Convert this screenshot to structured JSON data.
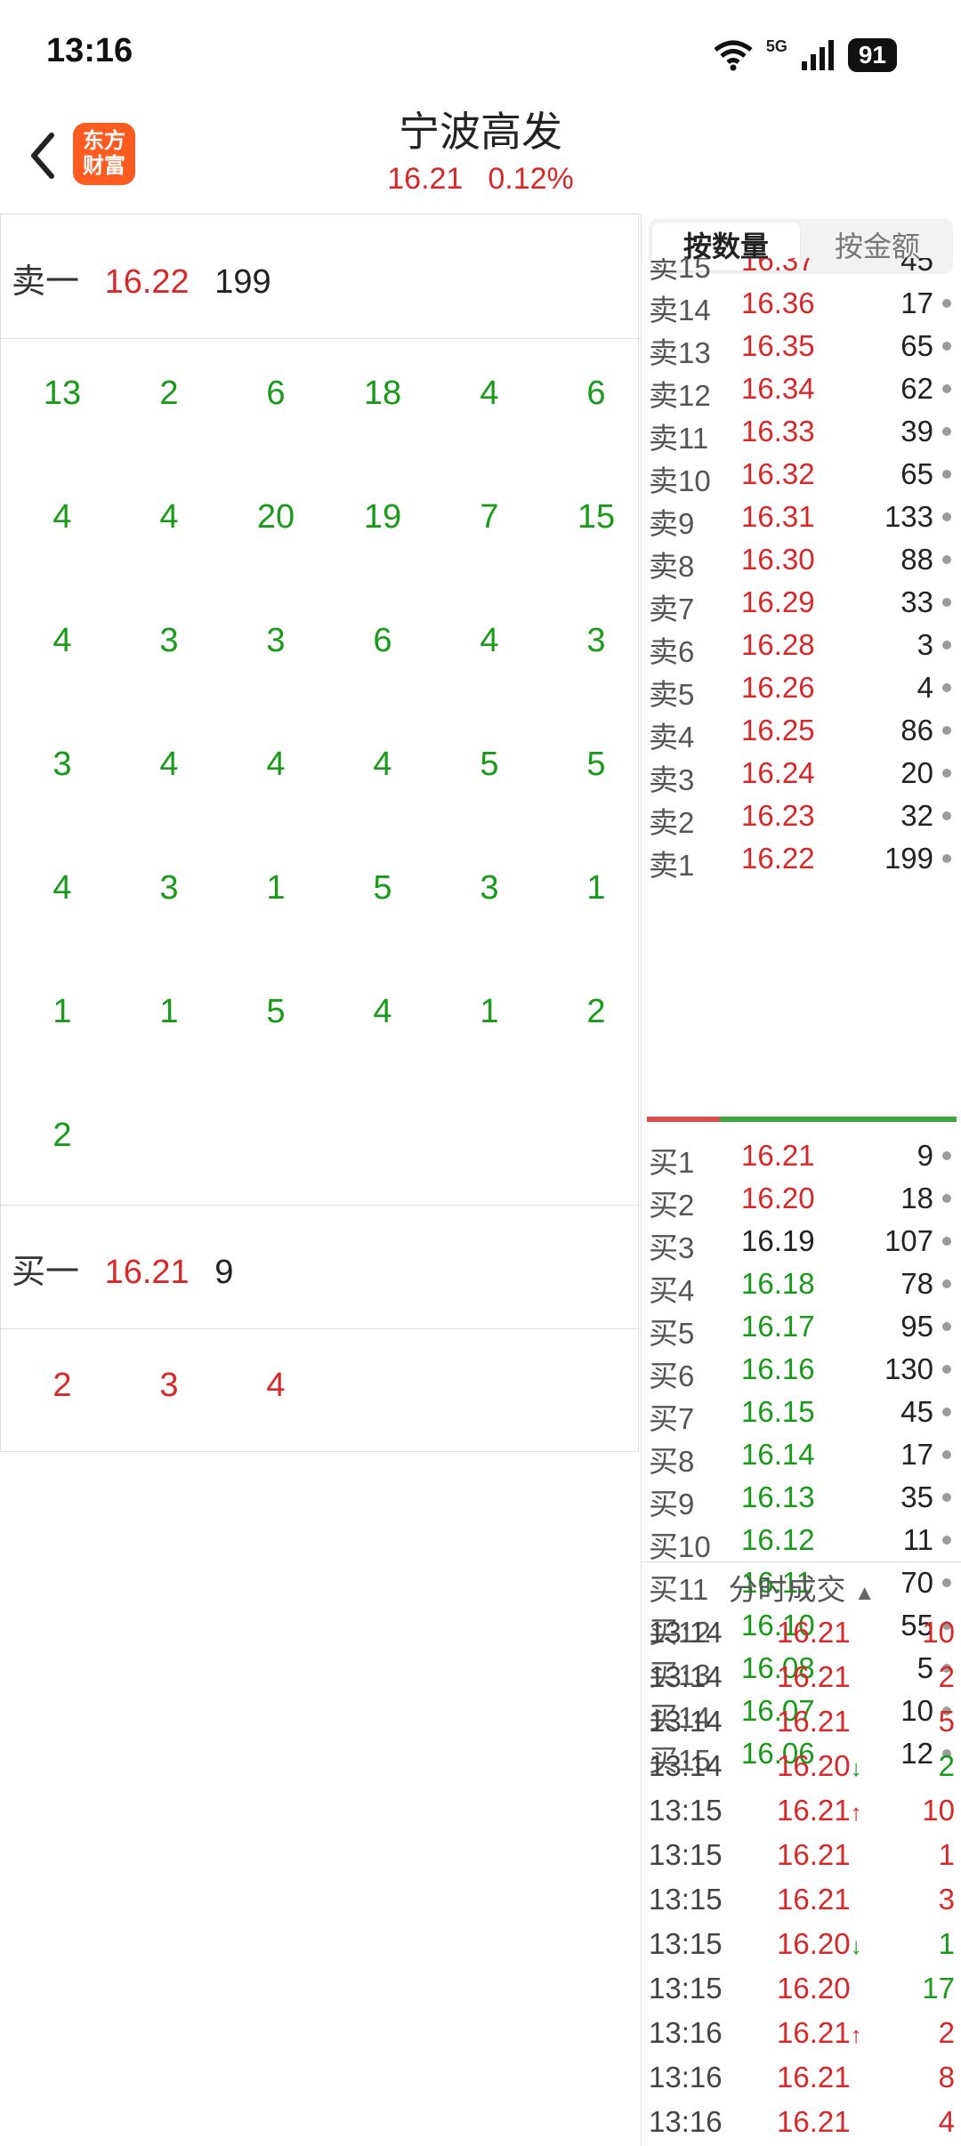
{
  "status_bar": {
    "time": "13:16",
    "network": "5G",
    "battery": "91"
  },
  "header": {
    "title": "宁波高发",
    "price": "16.21",
    "change_pct": "0.12%",
    "logo_text_line1": "东方",
    "logo_text_line2": "财富"
  },
  "left_panel": {
    "sell1": {
      "label": "卖一",
      "price": "16.22",
      "volume": "199"
    },
    "sell1_queue": [
      [
        "13",
        "2",
        "6",
        "18",
        "4",
        "6"
      ],
      [
        "4",
        "4",
        "20",
        "19",
        "7",
        "15"
      ],
      [
        "4",
        "3",
        "3",
        "6",
        "4",
        "3"
      ],
      [
        "3",
        "4",
        "4",
        "4",
        "5",
        "5"
      ],
      [
        "4",
        "3",
        "1",
        "5",
        "3",
        "1"
      ],
      [
        "1",
        "1",
        "5",
        "4",
        "1",
        "2"
      ],
      [
        "2"
      ]
    ],
    "buy1": {
      "label": "买一",
      "price": "16.21",
      "volume": "9"
    },
    "buy1_queue": [
      "2",
      "3",
      "4"
    ]
  },
  "right_panel": {
    "tabs": {
      "by_quantity": "按数量",
      "by_amount": "按金额"
    },
    "asks_partial": {
      "label": "卖15",
      "price": "16.37",
      "volume": "45"
    },
    "asks": [
      {
        "label": "卖14",
        "price": "16.36",
        "volume": "17"
      },
      {
        "label": "卖13",
        "price": "16.35",
        "volume": "65"
      },
      {
        "label": "卖12",
        "price": "16.34",
        "volume": "62"
      },
      {
        "label": "卖11",
        "price": "16.33",
        "volume": "39"
      },
      {
        "label": "卖10",
        "price": "16.32",
        "volume": "65"
      },
      {
        "label": "卖9",
        "price": "16.31",
        "volume": "133"
      },
      {
        "label": "卖8",
        "price": "16.30",
        "volume": "88"
      },
      {
        "label": "卖7",
        "price": "16.29",
        "volume": "33"
      },
      {
        "label": "卖6",
        "price": "16.28",
        "volume": "3"
      },
      {
        "label": "卖5",
        "price": "16.26",
        "volume": "4"
      },
      {
        "label": "卖4",
        "price": "16.25",
        "volume": "86"
      },
      {
        "label": "卖3",
        "price": "16.24",
        "volume": "20"
      },
      {
        "label": "卖2",
        "price": "16.23",
        "volume": "32"
      },
      {
        "label": "卖1",
        "price": "16.22",
        "volume": "199"
      }
    ],
    "bids": [
      {
        "label": "买1",
        "price": "16.21",
        "volume": "9",
        "color": "red"
      },
      {
        "label": "买2",
        "price": "16.20",
        "volume": "18",
        "color": "red"
      },
      {
        "label": "买3",
        "price": "16.19",
        "volume": "107",
        "color": "dark"
      },
      {
        "label": "买4",
        "price": "16.18",
        "volume": "78",
        "color": "green"
      },
      {
        "label": "买5",
        "price": "16.17",
        "volume": "95",
        "color": "green"
      },
      {
        "label": "买6",
        "price": "16.16",
        "volume": "130",
        "color": "green"
      },
      {
        "label": "买7",
        "price": "16.15",
        "volume": "45",
        "color": "green"
      },
      {
        "label": "买8",
        "price": "16.14",
        "volume": "17",
        "color": "green"
      },
      {
        "label": "买9",
        "price": "16.13",
        "volume": "35",
        "color": "green"
      },
      {
        "label": "买10",
        "price": "16.12",
        "volume": "11",
        "color": "green"
      },
      {
        "label": "买11",
        "price": "16.11",
        "volume": "70",
        "color": "green"
      },
      {
        "label": "买12",
        "price": "16.10",
        "volume": "55",
        "color": "green"
      },
      {
        "label": "买13",
        "price": "16.08",
        "volume": "5",
        "color": "green"
      },
      {
        "label": "买14",
        "price": "16.07",
        "volume": "10",
        "color": "green"
      },
      {
        "label": "买15",
        "price": "16.06",
        "volume": "12",
        "color": "green"
      }
    ],
    "trades_title": "分时成交",
    "trades": [
      {
        "time": "13:14",
        "price": "16.21",
        "arrow": "",
        "volume": "10",
        "vcolor": "red"
      },
      {
        "time": "13:14",
        "price": "16.21",
        "arrow": "",
        "volume": "2",
        "vcolor": "red"
      },
      {
        "time": "13:14",
        "price": "16.21",
        "arrow": "",
        "volume": "5",
        "vcolor": "red"
      },
      {
        "time": "13:14",
        "price": "16.20",
        "arrow": "↓",
        "volume": "2",
        "vcolor": "green"
      },
      {
        "time": "13:15",
        "price": "16.21",
        "arrow": "↑",
        "volume": "10",
        "vcolor": "red"
      },
      {
        "time": "13:15",
        "price": "16.21",
        "arrow": "",
        "volume": "1",
        "vcolor": "red"
      },
      {
        "time": "13:15",
        "price": "16.21",
        "arrow": "",
        "volume": "3",
        "vcolor": "red"
      },
      {
        "time": "13:15",
        "price": "16.20",
        "arrow": "↓",
        "volume": "1",
        "vcolor": "green"
      },
      {
        "time": "13:15",
        "price": "16.20",
        "arrow": "",
        "volume": "17",
        "vcolor": "green"
      },
      {
        "time": "13:16",
        "price": "16.21",
        "arrow": "↑",
        "volume": "2",
        "vcolor": "red"
      },
      {
        "time": "13:16",
        "price": "16.21",
        "arrow": "",
        "volume": "8",
        "vcolor": "red"
      },
      {
        "time": "13:16",
        "price": "16.21",
        "arrow": "",
        "volume": "4",
        "vcolor": "red"
      }
    ]
  }
}
